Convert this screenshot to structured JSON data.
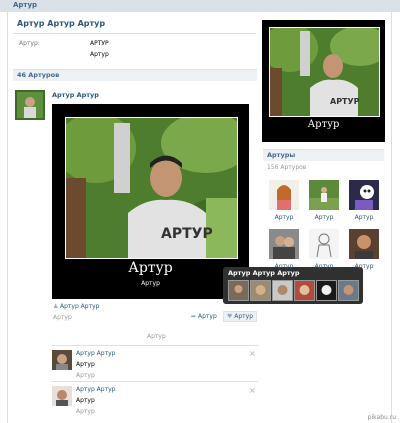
{
  "header": {
    "title": "Артур"
  },
  "profile": {
    "name": "Артур Артур Артур",
    "info_label": "Артур:",
    "info_values": [
      "АРТУР",
      "Артур"
    ]
  },
  "friends_section": {
    "title": "46 Артуров",
    "post_author": "Артур Артур",
    "demotivator_name": "Артур",
    "demotivator_caption": "Артур",
    "photo_caption": "Артур Артур",
    "photo_sub": "Артур",
    "share_button": "Артур",
    "like_button": "Артур",
    "divider_text": "Артур"
  },
  "like_tooltip": {
    "title": "Артур Артур Артур"
  },
  "comments": [
    {
      "author": "Артур Артур",
      "text": "Артур",
      "meta": "Артур"
    },
    {
      "author": "Артур Артур",
      "text": "Артур",
      "meta": "Артур"
    }
  ],
  "sidebar": {
    "avatar_name": "Артур",
    "section_title": "Артуры",
    "count": "156 Артуров",
    "friends": [
      "Артур",
      "Артур",
      "Артур",
      "Артур",
      "Артур",
      "Артур"
    ]
  },
  "watermark": "pikabu.ru",
  "icons": [
    "person-icon",
    "share-icon",
    "heart-icon",
    "close-icon"
  ],
  "colors": {
    "link": "#2b587a",
    "header_bg": "#dae2e8",
    "tooltip_bg": "#303030"
  }
}
